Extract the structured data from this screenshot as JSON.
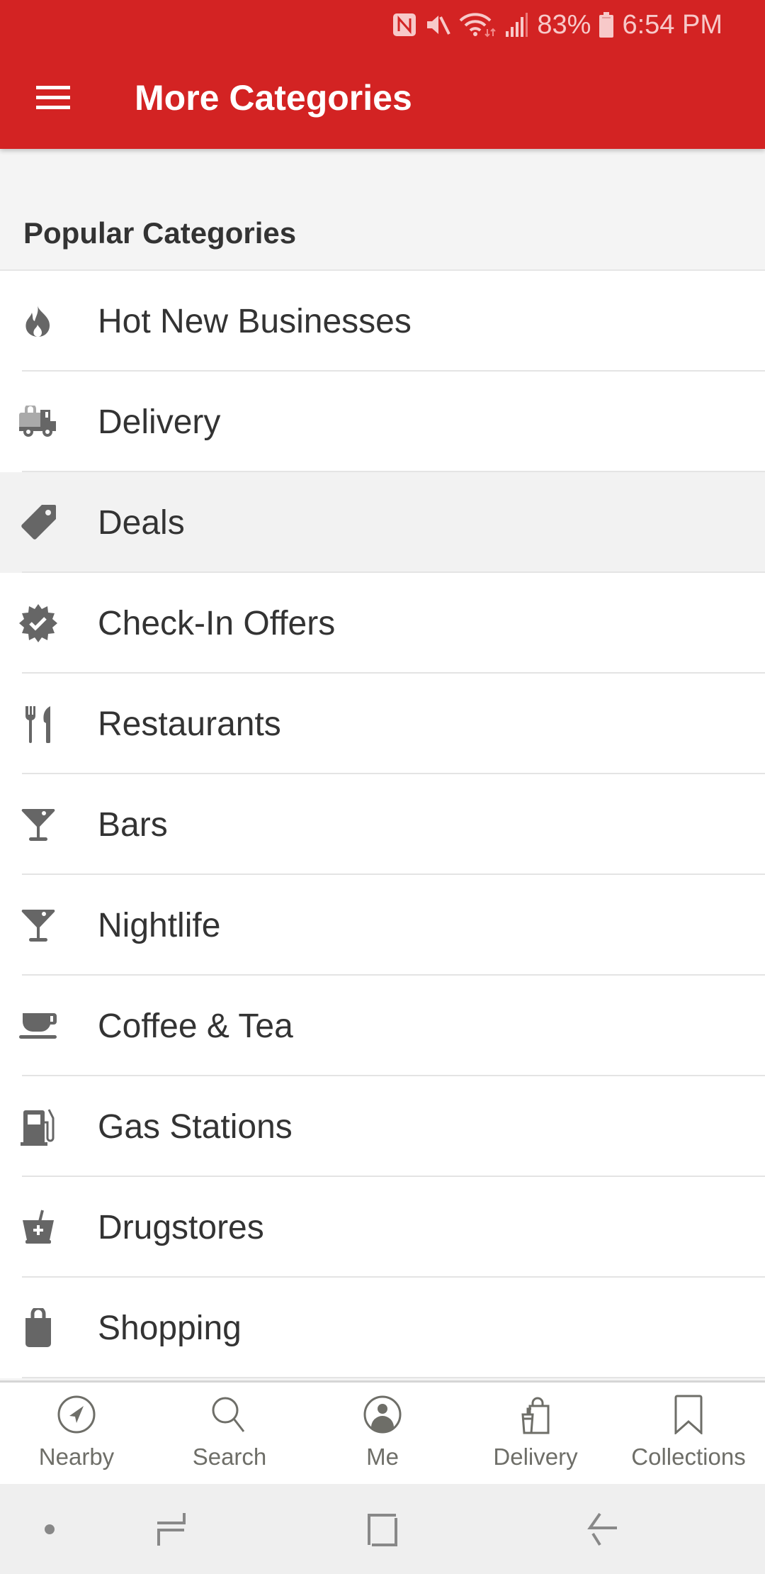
{
  "status_bar": {
    "battery_percent": "83%",
    "time": "6:54 PM",
    "icons": [
      "nfc-icon",
      "mute-icon",
      "wifi-icon",
      "signal-icon",
      "battery-icon"
    ]
  },
  "toolbar": {
    "menu_icon": "hamburger-menu-icon",
    "title": "More Categories"
  },
  "section": {
    "title": "Popular Categories"
  },
  "categories": [
    {
      "label": "Hot New Businesses",
      "icon": "flame-icon"
    },
    {
      "label": "Delivery",
      "icon": "delivery-truck-icon"
    },
    {
      "label": "Deals",
      "icon": "tag-icon",
      "pressed": true
    },
    {
      "label": "Check-In Offers",
      "icon": "verified-badge-icon"
    },
    {
      "label": "Restaurants",
      "icon": "fork-knife-icon"
    },
    {
      "label": "Bars",
      "icon": "cocktail-icon"
    },
    {
      "label": "Nightlife",
      "icon": "cocktail-icon"
    },
    {
      "label": "Coffee & Tea",
      "icon": "coffee-cup-icon"
    },
    {
      "label": "Gas Stations",
      "icon": "gas-pump-icon"
    },
    {
      "label": "Drugstores",
      "icon": "mortar-pestle-icon"
    },
    {
      "label": "Shopping",
      "icon": "shopping-bag-icon"
    }
  ],
  "bottom_nav": [
    {
      "label": "Nearby",
      "icon": "compass-icon"
    },
    {
      "label": "Search",
      "icon": "search-icon"
    },
    {
      "label": "Me",
      "icon": "profile-icon"
    },
    {
      "label": "Delivery",
      "icon": "delivery-bag-icon"
    },
    {
      "label": "Collections",
      "icon": "bookmark-icon"
    }
  ],
  "system_nav": [
    "dot-indicator",
    "recents-icon",
    "home-icon",
    "back-icon"
  ],
  "colors": {
    "brand_red": "#d32323",
    "icon_gray": "#666666",
    "text_dark": "#333333",
    "nav_gray": "#6e6e68"
  }
}
